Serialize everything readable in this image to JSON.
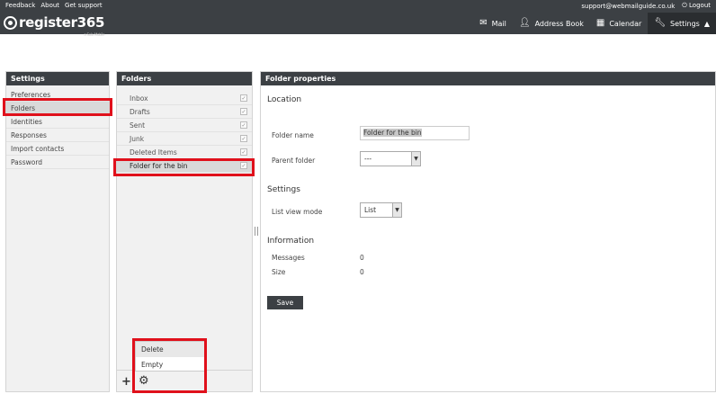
{
  "top_links": {
    "feedback": "Feedback",
    "about": "About",
    "get_support": "Get support",
    "user_email": "support@webmailguide.co.uk",
    "logout": "Logout"
  },
  "logo": {
    "text": "register365",
    "sub": "a Solo Mobile"
  },
  "nav": {
    "mail": "Mail",
    "address_book": "Address Book",
    "calendar": "Calendar",
    "settings": "Settings"
  },
  "settings_panel": {
    "title": "Settings",
    "items": [
      "Preferences",
      "Folders",
      "Identities",
      "Responses",
      "Import contacts",
      "Password"
    ]
  },
  "folders_panel": {
    "title": "Folders",
    "folders": [
      {
        "name": "Inbox",
        "check": "✓"
      },
      {
        "name": "Drafts",
        "check": "✓"
      },
      {
        "name": "Sent",
        "check": "✓"
      },
      {
        "name": "Junk",
        "check": "✓"
      },
      {
        "name": "Deleted Items",
        "check": "✓"
      },
      {
        "name": "Folder for the bin",
        "check": "✓"
      }
    ],
    "menu": {
      "delete": "Delete",
      "empty": "Empty"
    },
    "add_icon": "+",
    "gear_icon": "⚙"
  },
  "props_panel": {
    "title": "Folder properties",
    "location_title": "Location",
    "folder_name_label": "Folder name",
    "folder_name_value": "Folder for the bin",
    "parent_folder_label": "Parent folder",
    "parent_folder_value": "---",
    "settings_title": "Settings",
    "list_view_mode_label": "List view mode",
    "list_view_mode_value": "List",
    "information_title": "Information",
    "messages_label": "Messages",
    "messages_value": "0",
    "size_label": "Size",
    "size_value": "0",
    "save_label": "Save"
  },
  "colors": {
    "header_bg": "#3c4044",
    "highlight": "#e0101b",
    "selected_row": "#d9d9d9"
  }
}
